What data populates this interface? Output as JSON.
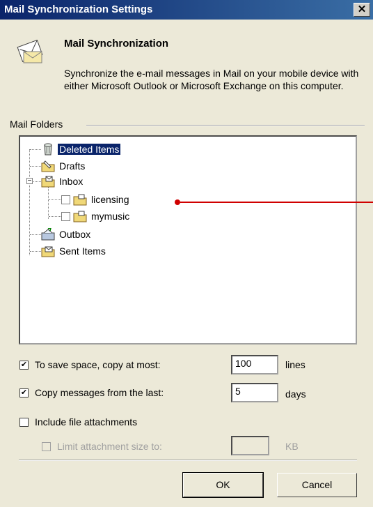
{
  "window": {
    "title": "Mail Synchronization Settings",
    "close_glyph": "✕"
  },
  "header": {
    "heading": "Mail Synchronization",
    "description": "Synchronize the e-mail messages in Mail on your mobile device with either Microsoft Outlook or Microsoft Exchange on this computer."
  },
  "folders": {
    "group_label": "Mail Folders",
    "items": [
      {
        "label": "Deleted Items",
        "icon": "trash-folder-icon",
        "selected": true
      },
      {
        "label": "Drafts",
        "icon": "drafts-folder-icon"
      },
      {
        "label": "Inbox",
        "icon": "inbox-folder-icon",
        "expander": "−"
      },
      {
        "label": "licensing",
        "icon": "folder-icon",
        "checked": false
      },
      {
        "label": "mymusic",
        "icon": "folder-icon",
        "checked": false
      },
      {
        "label": "Outbox",
        "icon": "outbox-folder-icon"
      },
      {
        "label": "Sent Items",
        "icon": "sent-folder-icon"
      }
    ]
  },
  "options": {
    "copy_at_most": {
      "label": "To save space, copy at most:",
      "checked": true,
      "value": "100",
      "unit": "lines"
    },
    "copy_from_last": {
      "label": "Copy messages from the last:",
      "checked": true,
      "value": "5",
      "unit": "days"
    },
    "include_attachments": {
      "label": "Include file attachments",
      "checked": false
    },
    "limit_attachment": {
      "label": "Limit attachment size to:",
      "checked": false,
      "disabled": true,
      "value": "",
      "unit": "KB"
    }
  },
  "buttons": {
    "ok": "OK",
    "cancel": "Cancel"
  },
  "check_glyph": "✔",
  "colors": {
    "titlebar": "#0a246a",
    "selection": "#0a246a",
    "annotation": "#d00000"
  }
}
